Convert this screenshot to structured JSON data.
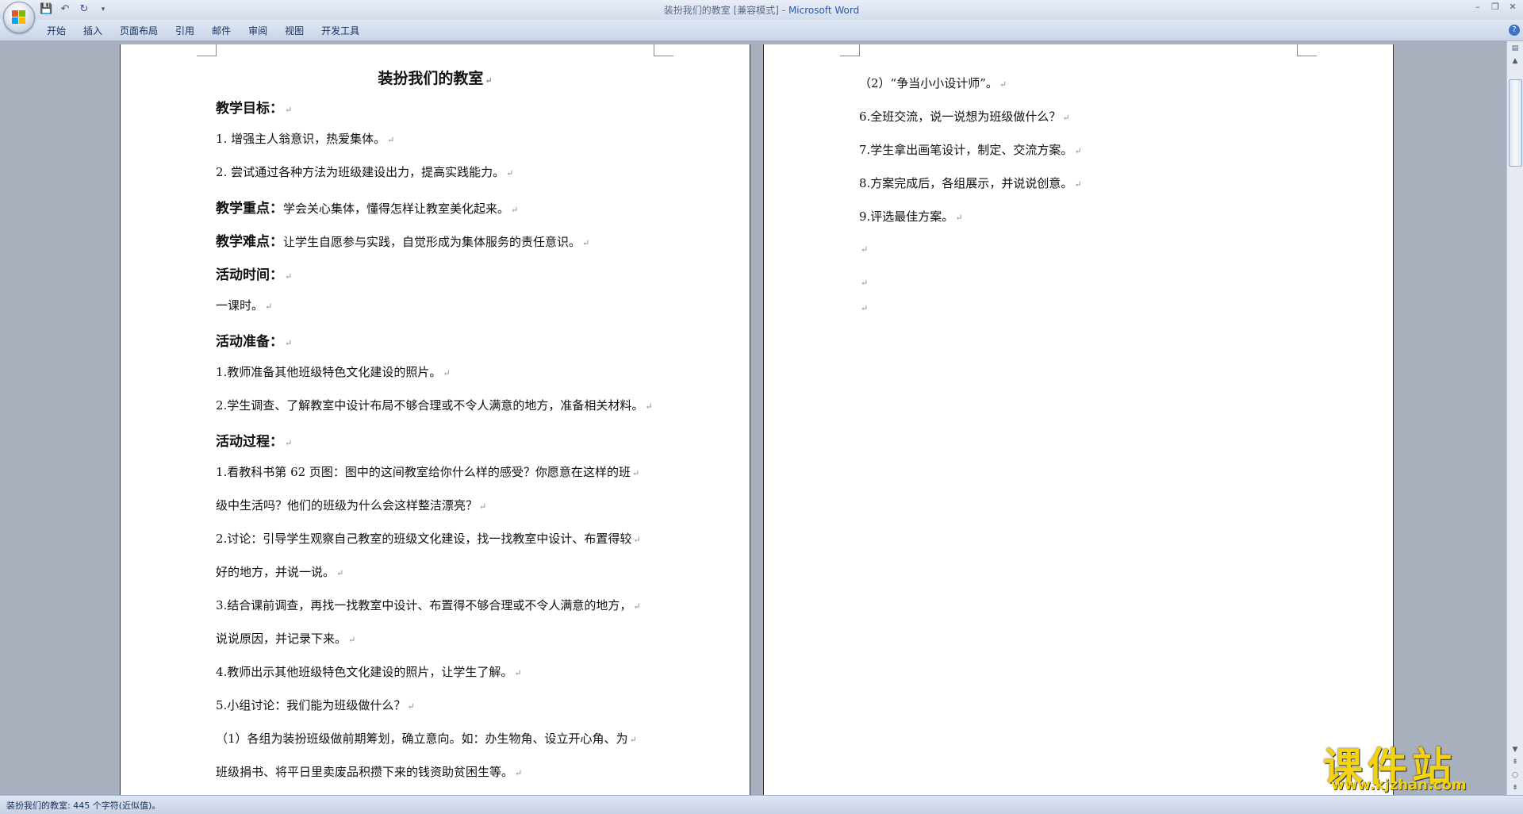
{
  "window": {
    "doc_name": "装扮我们的教室 [兼容模式]",
    "separator": " - ",
    "app_name": "Microsoft Word",
    "controls": [
      "–",
      "❐",
      "✕"
    ]
  },
  "ribbon": {
    "tabs": [
      "开始",
      "插入",
      "页面布局",
      "引用",
      "邮件",
      "审阅",
      "视图",
      "开发工具"
    ],
    "help": "?"
  },
  "doc": {
    "title": "装扮我们的教室",
    "page1": [
      {
        "label": "教学目标：",
        "text": ""
      },
      {
        "label": "",
        "text": "1. 增强主人翁意识，热爱集体。"
      },
      {
        "label": "",
        "text": "2. 尝试通过各种方法为班级建设出力，提高实践能力。"
      },
      {
        "label": "教学重点：",
        "text": "学会关心集体，懂得怎样让教室美化起来。"
      },
      {
        "label": "教学难点：",
        "text": "让学生自愿参与实践，自觉形成为集体服务的责任意识。"
      },
      {
        "label": "活动时间：",
        "text": ""
      },
      {
        "label": "",
        "text": "一课时。"
      },
      {
        "label": "活动准备：",
        "text": ""
      },
      {
        "label": "",
        "text": "1.教师准备其他班级特色文化建设的照片。"
      },
      {
        "label": "",
        "text": "2.学生调查、了解教室中设计布局不够合理或不令人满意的地方，准备相关材料。"
      },
      {
        "label": "活动过程：",
        "text": ""
      },
      {
        "label": "",
        "text": "1.看教科书第 62 页图：图中的这间教室给你什么样的感受？你愿意在这样的班"
      },
      {
        "label": "",
        "text": "级中生活吗？他们的班级为什么会这样整洁漂亮？"
      },
      {
        "label": "",
        "text": "2.讨论：引导学生观察自己教室的班级文化建设，找一找教室中设计、布置得较"
      },
      {
        "label": "",
        "text": "好的地方，并说一说。"
      },
      {
        "label": "",
        "text": "3.结合课前调查，再找一找教室中设计、布置得不够合理或不令人满意的地方，"
      },
      {
        "label": "",
        "text": "说说原因，并记录下来。"
      },
      {
        "label": "",
        "text": "4.教师出示其他班级特色文化建设的照片，让学生了解。"
      },
      {
        "label": "",
        "text": "5.小组讨论：我们能为班级做什么？"
      },
      {
        "label": "",
        "text": "（1）各组为装扮班级做前期筹划，确立意向。如：办生物角、设立开心角、为"
      },
      {
        "label": "",
        "text": "班级捐书、将平日里卖废品积攒下来的钱资助贫困生等。"
      }
    ],
    "page2": [
      {
        "text": "（2）“争当小小设计师”。"
      },
      {
        "text": "6.全班交流，说一说想为班级做什么？"
      },
      {
        "text": "7.学生拿出画笔设计，制定、交流方案。"
      },
      {
        "text": "8.方案完成后，各组展示，并说说创意。"
      },
      {
        "text": "9.评选最佳方案。"
      },
      {
        "text": ""
      },
      {
        "text": ""
      },
      {
        "text": ""
      }
    ],
    "paragraph_mark": "↵"
  },
  "status": {
    "text": "装扮我们的教室: 445 个字符(近似值)。"
  },
  "watermark": {
    "cn": "课件站",
    "url": "www.kjzhan.com"
  }
}
